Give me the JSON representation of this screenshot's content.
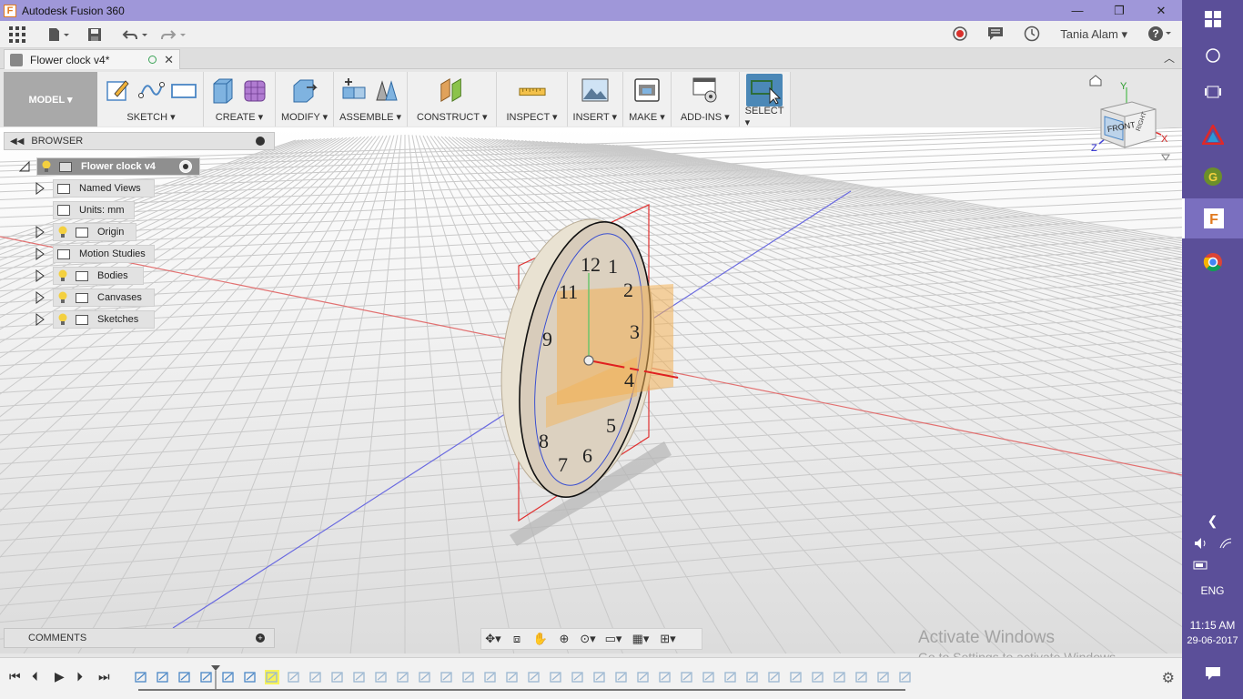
{
  "window": {
    "title": "Autodesk Fusion 360",
    "minimize": "—",
    "restore": "❐",
    "close": "✕"
  },
  "quick_access": {
    "user": "Tania Alam",
    "help": "?"
  },
  "document": {
    "tab_name": "Flower clock v4*"
  },
  "toolbar": {
    "workspace": "MODEL ▾",
    "groups": [
      {
        "label": "SKETCH ▾"
      },
      {
        "label": "CREATE ▾"
      },
      {
        "label": "MODIFY ▾"
      },
      {
        "label": "ASSEMBLE ▾"
      },
      {
        "label": "CONSTRUCT ▾"
      },
      {
        "label": "INSPECT ▾"
      },
      {
        "label": "INSERT ▾"
      },
      {
        "label": "MAKE ▾"
      },
      {
        "label": "ADD-INS ▾"
      },
      {
        "label": "SELECT ▾"
      }
    ]
  },
  "browser": {
    "title": "BROWSER",
    "root": "Flower clock v4",
    "items": [
      {
        "label": "Named Views"
      },
      {
        "label": "Units: mm"
      },
      {
        "label": "Origin"
      },
      {
        "label": "Motion Studies"
      },
      {
        "label": "Bodies"
      },
      {
        "label": "Canvases"
      },
      {
        "label": "Sketches"
      }
    ]
  },
  "viewcube": {
    "face": "FRONT",
    "side": "RIGHT",
    "axis_x": "X",
    "axis_y": "Y",
    "axis_z": "Z"
  },
  "clock_numbers": [
    "12",
    "1",
    "2",
    "3",
    "4",
    "5",
    "6",
    "7",
    "8",
    "9",
    "11"
  ],
  "comments": {
    "title": "COMMENTS"
  },
  "watermark": {
    "line1": "Activate Windows",
    "line2": "Go to Settings to activate Windows."
  },
  "taskbar": {
    "language": "ENG",
    "time": "11:15 AM",
    "date": "29-06-2017"
  },
  "colors": {
    "titlebar": "#9f97d9",
    "taskbar": "#5b4f99",
    "model_button": "#a9a9a9",
    "select_accent": "#4b88b7"
  }
}
